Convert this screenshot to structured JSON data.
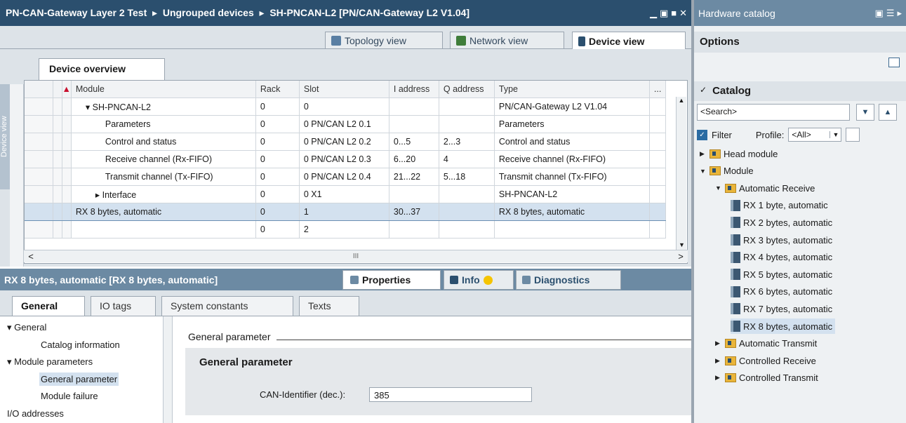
{
  "window": {
    "breadcrumb": "PN-CAN-Gateway Layer 2 Test  ▸  Ungrouped devices  ▸  SH-PNCAN-L2 [PN/CAN-Gateway L2 V1.04]",
    "controls": [
      "▁",
      "▣",
      "■",
      "✕"
    ]
  },
  "views": {
    "topology": "Topology view",
    "network": "Network view",
    "device": "Device view"
  },
  "device_overview": {
    "tab": "Device overview",
    "side_label": "Device view",
    "columns": [
      "",
      "...",
      "Module",
      "Rack",
      "Slot",
      "I address",
      "Q address",
      "Type",
      "..."
    ],
    "rows": [
      {
        "module": "▾  SH-PNCAN-L2",
        "rack": "0",
        "slot": "0",
        "i": "",
        "q": "",
        "type": "PN/CAN-Gateway L2 V1.04",
        "indent": 1
      },
      {
        "module": "Parameters",
        "rack": "0",
        "slot": "0 PN/CAN L2 0.1",
        "i": "",
        "q": "",
        "type": "Parameters",
        "indent": 3
      },
      {
        "module": "Control and status",
        "rack": "0",
        "slot": "0 PN/CAN L2 0.2",
        "i": "0...5",
        "q": "2...3",
        "type": "Control and status",
        "indent": 3
      },
      {
        "module": "Receive channel (Rx-FIFO)",
        "rack": "0",
        "slot": "0 PN/CAN L2 0.3",
        "i": "6...20",
        "q": "4",
        "type": "Receive channel (Rx-FIFO)",
        "indent": 3
      },
      {
        "module": "Transmit channel (Tx-FIFO)",
        "rack": "0",
        "slot": "0 PN/CAN L2 0.4",
        "i": "21...22",
        "q": "5...18",
        "type": "Transmit channel (Tx-FIFO)",
        "indent": 3
      },
      {
        "module": "▸  Interface",
        "rack": "0",
        "slot": "0 X1",
        "i": "",
        "q": "",
        "type": "SH-PNCAN-L2",
        "indent": 2
      },
      {
        "module": "RX 8 bytes, automatic",
        "rack": "0",
        "slot": "1",
        "i": "30...37",
        "q": "",
        "type": "RX 8 bytes, automatic",
        "indent": 0,
        "selected": true
      },
      {
        "module": "",
        "rack": "0",
        "slot": "2",
        "i": "",
        "q": "",
        "type": "",
        "indent": 0
      }
    ],
    "scroll_marker": "III"
  },
  "properties": {
    "title": "RX 8 bytes, automatic [RX 8 bytes, automatic]",
    "tabs_right": {
      "properties": "Properties",
      "info": "Info",
      "diagnostics": "Diagnostics"
    },
    "tabs": [
      "General",
      "IO tags",
      "System constants",
      "Texts"
    ],
    "nav": [
      {
        "label": "▾ General",
        "level": 0
      },
      {
        "label": "Catalog information",
        "level": 1
      },
      {
        "label": "▾ Module parameters",
        "level": 0
      },
      {
        "label": "General parameter",
        "level": 1,
        "selected": true
      },
      {
        "label": "Module failure",
        "level": 1
      },
      {
        "label": "I/O addresses",
        "level": 0
      }
    ],
    "section_header": "General parameter",
    "group_title": "General parameter",
    "can_id_label": "CAN-Identifier (dec.):",
    "can_id_value": "385"
  },
  "catalog": {
    "title": "Hardware catalog",
    "options": "Options",
    "section": "Catalog",
    "search_placeholder": "<Search>",
    "filter_label": "Filter",
    "profile_label": "Profile:",
    "profile_value": "<All>",
    "tree": [
      {
        "label": "Head module",
        "type": "folder",
        "level": 0,
        "open": false
      },
      {
        "label": "Module",
        "type": "folder",
        "level": 0,
        "open": true
      },
      {
        "label": "Automatic Receive",
        "type": "folder",
        "level": 1,
        "open": true
      },
      {
        "label": "RX 1 byte, automatic",
        "type": "module",
        "level": 2
      },
      {
        "label": "RX 2 bytes, automatic",
        "type": "module",
        "level": 2
      },
      {
        "label": "RX 3 bytes, automatic",
        "type": "module",
        "level": 2
      },
      {
        "label": "RX 4 bytes, automatic",
        "type": "module",
        "level": 2
      },
      {
        "label": "RX 5 bytes, automatic",
        "type": "module",
        "level": 2
      },
      {
        "label": "RX 6 bytes, automatic",
        "type": "module",
        "level": 2
      },
      {
        "label": "RX 7 bytes, automatic",
        "type": "module",
        "level": 2
      },
      {
        "label": "RX 8 bytes, automatic",
        "type": "module",
        "level": 2,
        "selected": true
      },
      {
        "label": "Automatic Transmit",
        "type": "folder",
        "level": 1,
        "open": false
      },
      {
        "label": "Controlled Receive",
        "type": "folder",
        "level": 1,
        "open": false
      },
      {
        "label": "Controlled Transmit",
        "type": "folder",
        "level": 1,
        "open": false
      }
    ]
  },
  "colors": {
    "titlebar": "#2b4f6e",
    "titlebar_light": "#6c8aa3",
    "selection": "#d3e1ef",
    "panel": "#dde3e8"
  }
}
